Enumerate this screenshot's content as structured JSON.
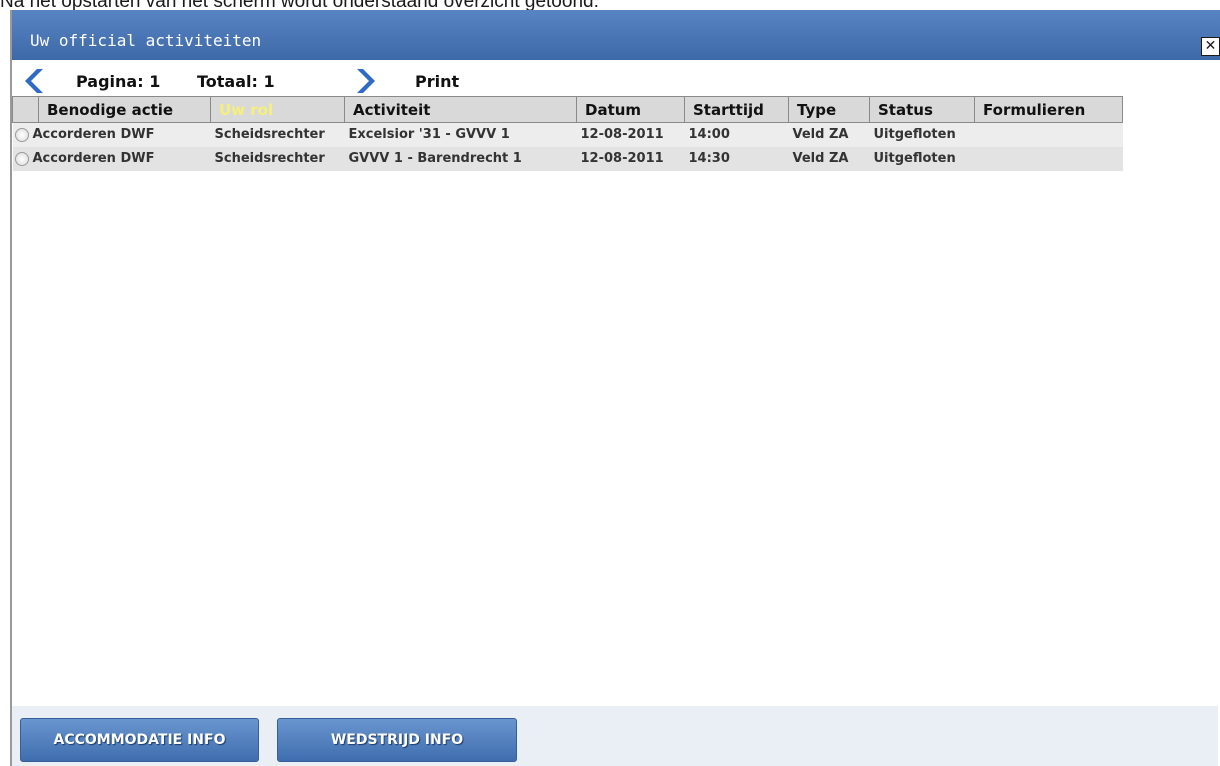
{
  "caption": "Na het opstarten van het scherm wordt onderstaand overzicht getoond:",
  "window": {
    "title": "Uw official activiteiten",
    "close_label": "✕"
  },
  "toolbar": {
    "page_label": "Pagina: 1",
    "total_label": "Totaal: 1",
    "print_label": "Print"
  },
  "table": {
    "headers": [
      "Benodige actie",
      "Uw rol",
      "Activiteit",
      "Datum",
      "Starttijd",
      "Type",
      "Status",
      "Formulieren"
    ],
    "active_header": "Uw rol",
    "rows": [
      {
        "actie": "Accorderen DWF",
        "rol": "Scheidsrechter",
        "activiteit": "Excelsior '31 - GVVV 1",
        "datum": "12-08-2011",
        "starttijd": "14:00",
        "type": "Veld ZA",
        "status": "Uitgefloten",
        "formulieren": ""
      },
      {
        "actie": "Accorderen DWF",
        "rol": "Scheidsrechter",
        "activiteit": "GVVV 1 - Barendrecht 1",
        "datum": "12-08-2011",
        "starttijd": "14:30",
        "type": "Veld ZA",
        "status": "Uitgefloten",
        "formulieren": ""
      }
    ]
  },
  "footer": {
    "accommodatie_label": "ACCOMMODATIE INFO",
    "wedstrijd_label": "WEDSTRIJD INFO"
  },
  "colors": {
    "titlebar": "#4a75b5",
    "header_bg": "#d9d9d9",
    "active_header_text": "#f6f07a",
    "nav_arrow": "#2f6bc4",
    "button": "#5282c2"
  },
  "icons": {
    "prev": "chevron-left-icon",
    "next": "chevron-right-icon",
    "close": "close-icon",
    "row_select": "radio-icon"
  }
}
